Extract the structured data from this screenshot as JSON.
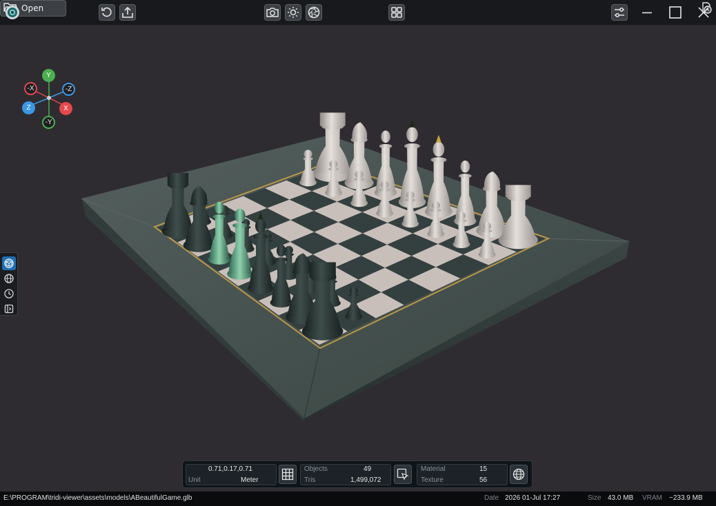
{
  "toolbar": {
    "open_label": "Open",
    "icons": [
      "app-logo-icon",
      "folder-open-icon",
      "history-icon",
      "reset-icon",
      "export-icon",
      "screenshot-icon",
      "lighting-icon",
      "aperture-icon",
      "layout-grid-icon",
      "settings-sliders-icon",
      "minimize-icon",
      "maximize-icon",
      "close-icon"
    ]
  },
  "gizmo": {
    "y": "Y",
    "neg_x": "-X",
    "neg_z": "-Z",
    "z": "Z",
    "x": "X",
    "neg_y": "-Y",
    "colors": {
      "x": "#e5484d",
      "y": "#4caf50",
      "z": "#3b97e3"
    }
  },
  "sidepanel": {
    "items": [
      "model-view-icon",
      "environment-globe-icon",
      "animation-clock-icon",
      "panel-toggle-icon"
    ]
  },
  "info": {
    "scale_value": "0.71,0.17,0.71",
    "unit_label": "Unit",
    "unit_value": "Meter",
    "objects_label": "Objects",
    "objects_value": "49",
    "tris_label": "Tris",
    "tris_value": "1,499,072",
    "material_label": "Material",
    "material_value": "15",
    "texture_label": "Texture",
    "texture_value": "56"
  },
  "status": {
    "path": "E:\\PROGRAM\\tridi-viewer\\assets\\models\\ABeautifulGame.glb",
    "date_label": "Date",
    "date_value": "2026 01-Jul 17:27",
    "size_label": "Size",
    "size_value": "43.0 MB",
    "vram_label": "VRAM",
    "vram_value": "~233.9 MB"
  },
  "colors": {
    "accent": "#1f6fb0",
    "board_frame": "#3f4a4a",
    "light_square": "#c9bfba",
    "dark_square": "#34403f",
    "light_piece": "#d6d0cb",
    "dark_piece": "#2a3534"
  }
}
